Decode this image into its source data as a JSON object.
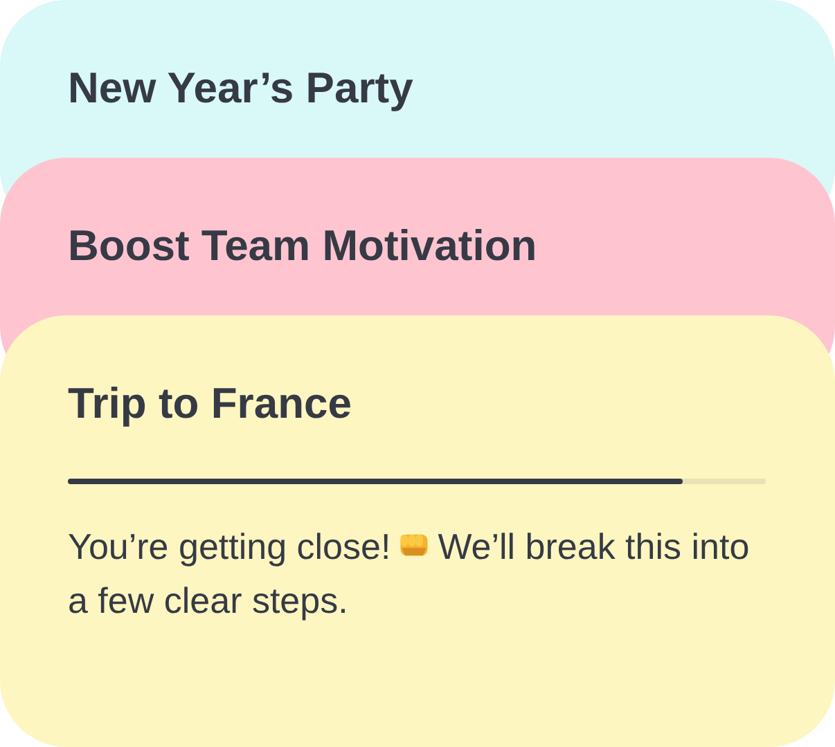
{
  "cards": [
    {
      "title": "New Year’s Party",
      "color": "#d9f8f8"
    },
    {
      "title": "Boost Team Motivation",
      "color": "#fec5d1"
    },
    {
      "title": "Trip to France",
      "color": "#fdf6c0",
      "progress": {
        "level": 0.88
      },
      "message_before": "You’re getting close!",
      "message_after": "We’ll break this into a few clear steps."
    }
  ]
}
